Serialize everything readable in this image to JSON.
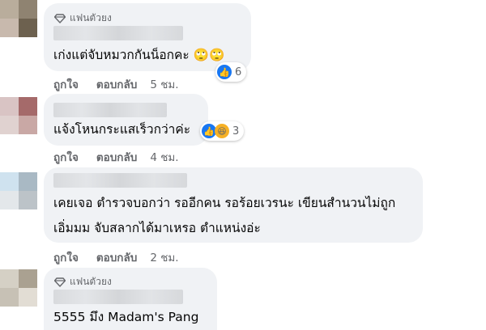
{
  "comments": [
    {
      "badge": "แฟนตัวยง",
      "text": "เก่งแต่จับหมวกกันน็อกคะ 🙄🙄",
      "like": "ถูกใจ",
      "reply": "ตอบกลับ",
      "time": "5 ชม.",
      "reaction_count": "6",
      "reactions": [
        "like-icon"
      ]
    },
    {
      "text": "แจ้งโหนกระแสเร็วกว่าค่ะ",
      "like": "ถูกใจ",
      "reply": "ตอบกลับ",
      "time": "4 ชม.",
      "reaction_count": "3",
      "reactions": [
        "like-icon",
        "haha-icon"
      ]
    },
    {
      "text_line1": "เคยเจอ ตำรวจบอกว่า รออีกคน รอร้อยเวรนะ เขียนสำนวนไม่ถูก",
      "text_line2": "เอิ่มมม จับสลากได้มาเหรอ ตำแหน่งอ่ะ",
      "like": "ถูกใจ",
      "reply": "ตอบกลับ",
      "time": "2 ชม."
    },
    {
      "badge": "แฟนตัวยง",
      "text": "5555 มึง Madam's Pang"
    }
  ],
  "colors": {
    "bubble": "#f0f2f5",
    "meta_text": "#65676b",
    "like_blue": "#1877f2",
    "haha_yellow": "#f7b125"
  }
}
